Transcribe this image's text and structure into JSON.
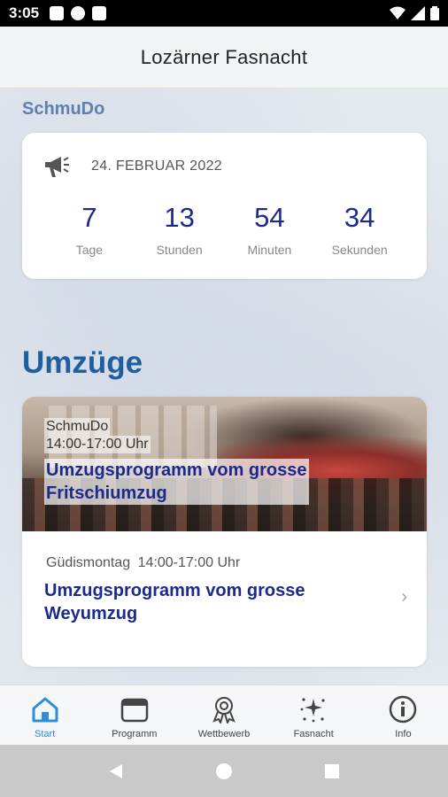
{
  "status_bar": {
    "time": "3:05"
  },
  "app_bar": {
    "title": "Lozärner Fasnacht"
  },
  "countdown_section": {
    "label": "SchmuDo",
    "date": "24. FEBRUAR 2022",
    "units": [
      {
        "value": "7",
        "label": "Tage"
      },
      {
        "value": "13",
        "label": "Stunden"
      },
      {
        "value": "54",
        "label": "Minuten"
      },
      {
        "value": "34",
        "label": "Sekunden"
      }
    ]
  },
  "parades": {
    "heading": "Umzüge",
    "items": [
      {
        "day": "SchmuDo",
        "time": "14:00-17:00 Uhr",
        "title_line1": "Umzugsprogramm vom grosse",
        "title_line2": "Fritschiumzug"
      },
      {
        "day": "Güdismontag",
        "time": "14:00-17:00 Uhr",
        "title_line1": "Umzugsprogramm vom grosse",
        "title_line2": "Weyumzug"
      }
    ]
  },
  "bottom_nav": {
    "items": [
      {
        "label": "Start",
        "icon": "home-icon"
      },
      {
        "label": "Programm",
        "icon": "calendar-icon"
      },
      {
        "label": "Wettbewerb",
        "icon": "award-icon"
      },
      {
        "label": "Fasnacht",
        "icon": "sparkle-icon"
      },
      {
        "label": "Info",
        "icon": "info-icon"
      }
    ]
  },
  "colors": {
    "accent": "#2e8fd8",
    "title_blue": "#1c2a8c",
    "heading_blue": "#1f5fa0",
    "section_label": "#5f7fae"
  }
}
